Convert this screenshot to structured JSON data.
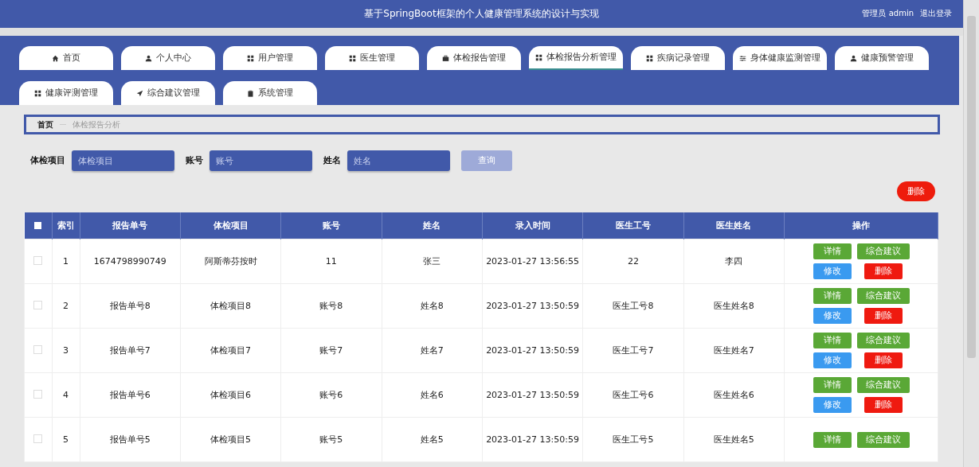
{
  "header": {
    "title": "基于SpringBoot框架的个人健康管理系统的设计与实现",
    "user": "管理员 admin",
    "logout": "退出登录"
  },
  "nav": [
    {
      "label": "首页",
      "kind": "home",
      "selected": false
    },
    {
      "label": "个人中心",
      "kind": "user",
      "selected": false
    },
    {
      "label": "用户管理",
      "kind": "grid",
      "selected": false
    },
    {
      "label": "医生管理",
      "kind": "grid",
      "selected": false
    },
    {
      "label": "体检报告管理",
      "kind": "briefcase",
      "selected": false
    },
    {
      "label": "体检报告分析管理",
      "kind": "grid",
      "selected": true
    },
    {
      "label": "疾病记录管理",
      "kind": "grid",
      "selected": false
    },
    {
      "label": "身体健康监测管理",
      "kind": "sliders",
      "selected": false
    },
    {
      "label": "健康预警管理",
      "kind": "user",
      "selected": false
    },
    {
      "label": "健康评测管理",
      "kind": "grid",
      "selected": false
    },
    {
      "label": "综合建议管理",
      "kind": "send",
      "selected": false
    },
    {
      "label": "系统管理",
      "kind": "clipboard",
      "selected": false
    }
  ],
  "breadcrumb": [
    "首页",
    "体检报告分析"
  ],
  "search": [
    {
      "label": "体检项目",
      "placeholder": "体检项目"
    },
    {
      "label": "账号",
      "placeholder": "账号"
    },
    {
      "label": "姓名",
      "placeholder": "姓名"
    }
  ],
  "query_button": "查询",
  "delete_button": "删除",
  "table": {
    "select_all_checked": false,
    "columns": [
      "索引",
      "报告单号",
      "体检项目",
      "账号",
      "姓名",
      "录入时间",
      "医生工号",
      "医生姓名",
      "操作"
    ],
    "rows": [
      {
        "checked": false,
        "cells": [
          "1",
          "1674798990749",
          "阿斯蒂芬按时",
          "11",
          "张三",
          "2023-01-27 13:56:55",
          "22",
          "李四"
        ],
        "actions": [
          "详情",
          "综合建议",
          "修改",
          "删除"
        ]
      },
      {
        "checked": false,
        "cells": [
          "2",
          "报告单号8",
          "体检项目8",
          "账号8",
          "姓名8",
          "2023-01-27 13:50:59",
          "医生工号8",
          "医生姓名8"
        ],
        "actions": [
          "详情",
          "综合建议",
          "修改",
          "删除"
        ]
      },
      {
        "checked": false,
        "cells": [
          "3",
          "报告单号7",
          "体检项目7",
          "账号7",
          "姓名7",
          "2023-01-27 13:50:59",
          "医生工号7",
          "医生姓名7"
        ],
        "actions": [
          "详情",
          "综合建议",
          "修改",
          "删除"
        ]
      },
      {
        "checked": false,
        "cells": [
          "4",
          "报告单号6",
          "体检项目6",
          "账号6",
          "姓名6",
          "2023-01-27 13:50:59",
          "医生工号6",
          "医生姓名6"
        ],
        "actions": [
          "详情",
          "综合建议",
          "修改",
          "删除"
        ]
      },
      {
        "checked": false,
        "cells": [
          "5",
          "报告单号5",
          "体检项目5",
          "账号5",
          "姓名5",
          "2023-01-27 13:50:59",
          "医生工号5",
          "医生姓名5"
        ],
        "actions": [
          "详情",
          "综合建议"
        ]
      }
    ]
  }
}
